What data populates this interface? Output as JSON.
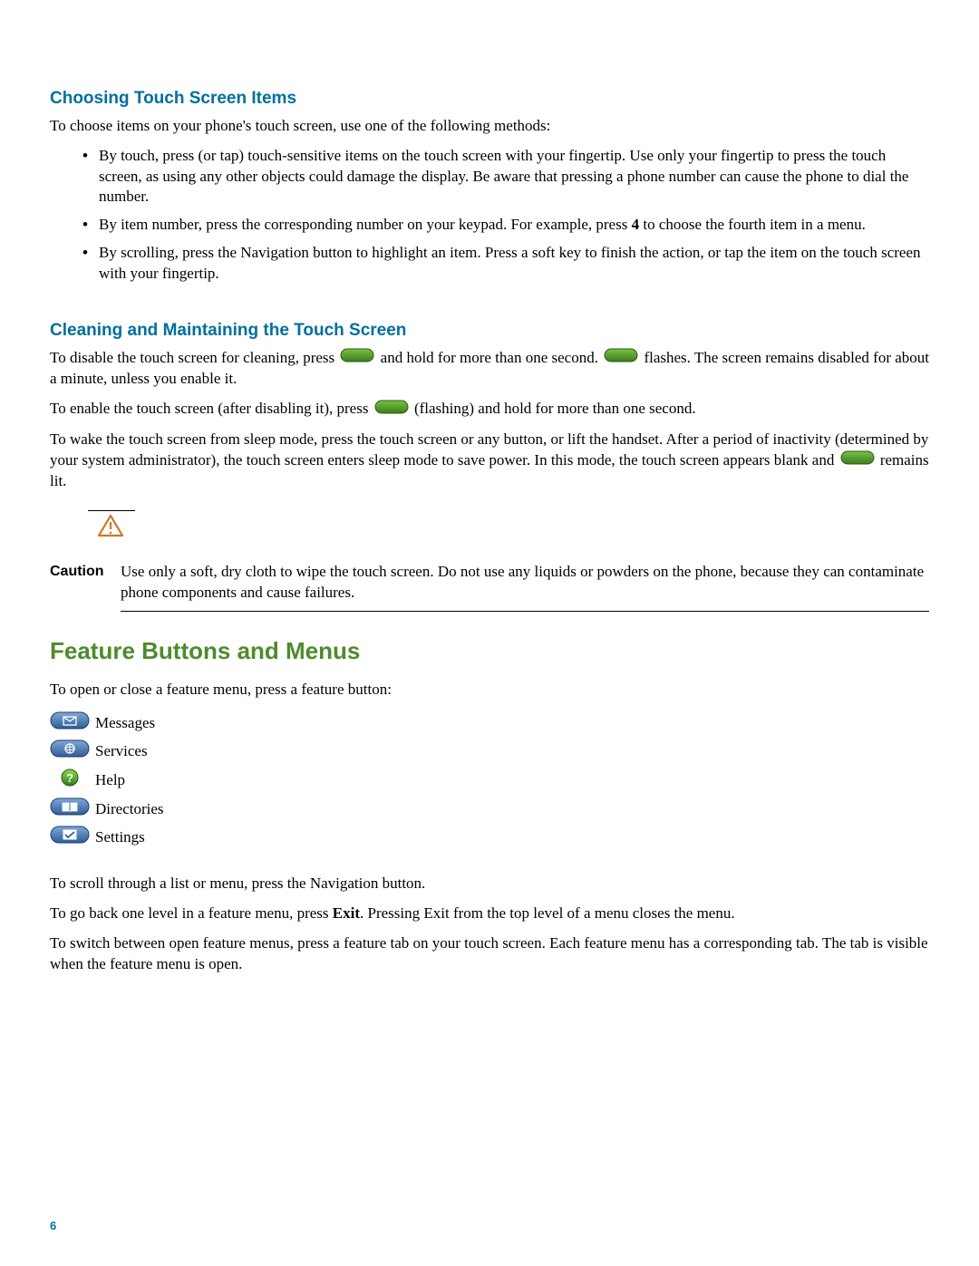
{
  "section1": {
    "heading": "Choosing Touch Screen Items",
    "intro": "To choose items on your phone's touch screen, use one of the following methods:",
    "bullets": {
      "b1a": "By touch, press (or tap) touch-sensitive items on the touch screen with your fingertip. Use only your fingertip to press the touch screen, as using any other objects could damage the display. Be aware that pressing a phone number can cause the phone to dial the number.",
      "b2a": "By item number, press the corresponding number on your keypad. For example, press ",
      "b2bold": "4",
      "b2b": " to choose the fourth item in a menu.",
      "b3a": "By scrolling, press the Navigation button to highlight an item. Press a soft key to finish the action, or tap the item on the touch screen with your fingertip."
    }
  },
  "section2": {
    "heading": "Cleaning and Maintaining the Touch Screen",
    "p1a": "To disable the touch screen for cleaning, press ",
    "p1b": " and hold for more than one second. ",
    "p1c": " flashes. The screen remains disabled for about a minute, unless you enable it.",
    "p2a": "To enable the touch screen (after disabling it), press ",
    "p2b": " (flashing) and hold for more than one second.",
    "p3a": "To wake the touch screen from sleep mode, press the touch screen or any button, or lift the handset. After a period of inactivity (determined by your system administrator), the touch screen enters sleep mode to save power. In this mode, the touch screen appears blank and ",
    "p3b": " remains lit."
  },
  "caution": {
    "label": "Caution",
    "text": "Use only a soft, dry cloth to wipe the touch screen. Do not use any liquids or powders on the phone, because they can contaminate phone components and cause failures."
  },
  "section3": {
    "heading": "Feature Buttons and Menus",
    "intro": "To open or close a feature menu, press a feature button:",
    "buttons": {
      "messages": "Messages",
      "services": "Services",
      "help": "Help",
      "directories": "Directories",
      "settings": "Settings"
    },
    "p1": "To scroll through a list or menu, press the Navigation button.",
    "p2a": "To go back one level in a feature menu, press ",
    "p2bold": "Exit",
    "p2b": ". Pressing Exit from the top level of a menu closes the menu.",
    "p3": "To switch between open feature menus, press a feature tab on your touch screen. Each feature menu has a corresponding tab. The tab is visible when the feature menu is open."
  },
  "page_number": "6"
}
